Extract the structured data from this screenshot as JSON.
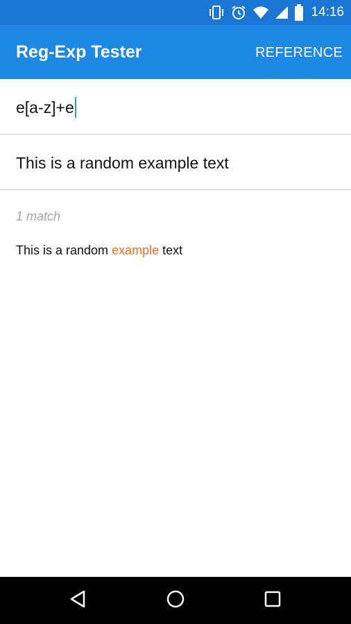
{
  "status_bar": {
    "time": "14:16",
    "icons": [
      "vibrate-icon",
      "alarm-icon",
      "wifi-icon",
      "signal-icon",
      "battery-icon"
    ],
    "background_color": "#1976d2"
  },
  "app_bar": {
    "title": "Reg-Exp Tester",
    "action_label": "REFERENCE",
    "background_color": "#1e88e5"
  },
  "regex_input": {
    "value": "e[a-z]+e"
  },
  "text_input": {
    "value": "This is a random example text"
  },
  "results": {
    "match_count": "1 match",
    "text_before": "This is a random ",
    "match": "example",
    "text_after": " text",
    "highlight_color": "#e8711c"
  },
  "nav_bar": {
    "buttons": [
      "back-icon",
      "home-icon",
      "recents-icon"
    ]
  }
}
